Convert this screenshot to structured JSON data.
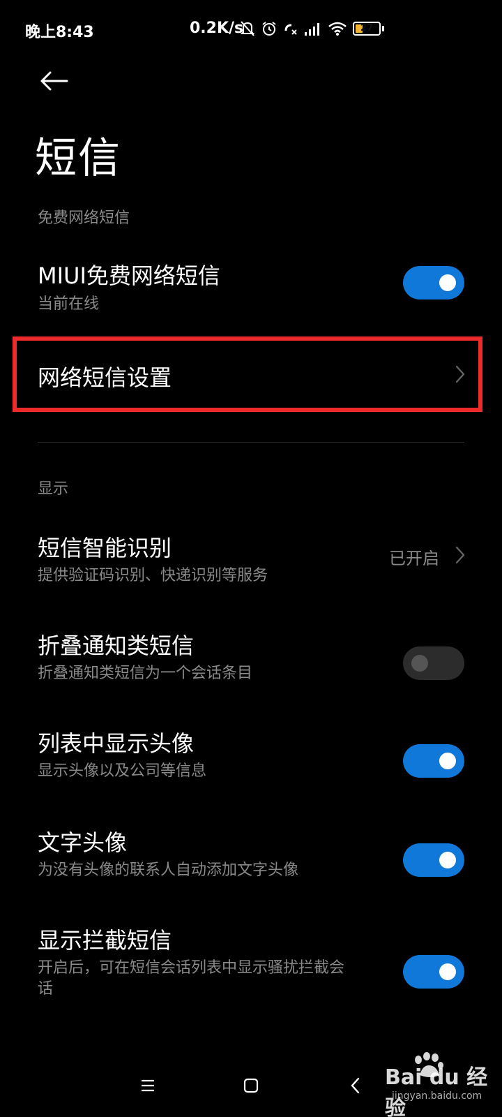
{
  "status_bar": {
    "time": "晚上8:43",
    "net_speed": "0.2K/s",
    "battery": "27",
    "icons": [
      "mute-bell-icon",
      "alarm-icon",
      "call-icon",
      "signal-icon",
      "wifi-icon",
      "battery-icon"
    ]
  },
  "header": {
    "back_icon": "arrow-left-icon",
    "title": "短信"
  },
  "sections": {
    "free_sms": {
      "header": "免费网络短信",
      "miui_sms": {
        "title": "MIUI免费网络短信",
        "subtitle": "当前在线",
        "toggle_on": true
      },
      "sms_settings": {
        "title": "网络短信设置"
      }
    },
    "display": {
      "header": "显示",
      "smart_recognition": {
        "title": "短信智能识别",
        "subtitle": "提供验证码识别、快递识别等服务",
        "value": "已开启"
      },
      "fold_notifications": {
        "title": "折叠通知类短信",
        "subtitle": "折叠通知类短信为一个会话条目",
        "toggle_on": false
      },
      "show_avatar": {
        "title": "列表中显示头像",
        "subtitle": "显示头像以及公司等信息",
        "toggle_on": true
      },
      "text_avatar": {
        "title": "文字头像",
        "subtitle": "为没有头像的联系人自动添加文字头像",
        "toggle_on": true
      },
      "show_blocked": {
        "title": "显示拦截短信",
        "subtitle_line1": "开启后，可在短信会话列表中显示骚扰拦截会",
        "subtitle_line2": "话",
        "toggle_on": true
      }
    }
  },
  "nav_bar": {
    "icons": [
      "menu-icon",
      "home-icon",
      "back-icon"
    ]
  },
  "watermark": {
    "logo": "Bai du 经验",
    "url": "jingyan.baidu.com"
  },
  "colors": {
    "background": "#000000",
    "accent": "#0f78d8",
    "highlight": "#ee2a2a",
    "secondary_text": "#8a8a8a"
  }
}
